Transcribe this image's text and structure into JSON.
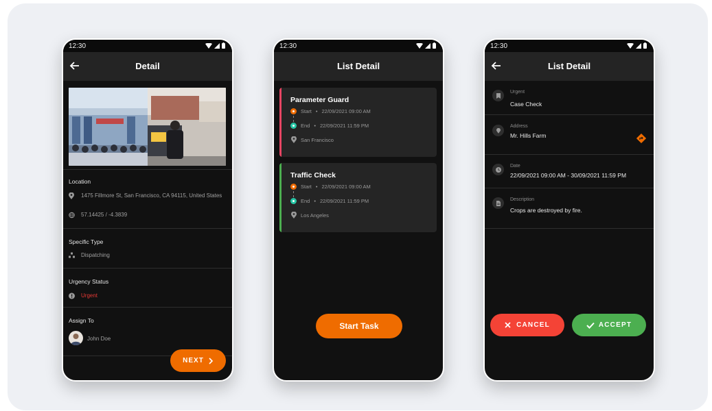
{
  "status_time": "12:30",
  "detail": {
    "title": "Detail",
    "location_title": "Location",
    "address": "1475 Fillmore St, San Francisco, CA 94115, United States",
    "coords": "57.14425 / -4.3839",
    "specific_type_title": "Specific Type",
    "specific_type": "Dispatching",
    "urgency_title": "Urgency Status",
    "urgency": "Urgent",
    "assign_title": "Assign To",
    "assignee": "John Doe",
    "next_label": "NEXT",
    "colors": {
      "urgent": "#e53935",
      "accent": "#ef6c00"
    }
  },
  "list": {
    "title": "List Detail",
    "tasks": [
      {
        "title": "Parameter Guard",
        "start_label": "Start",
        "start": "22/09/2021 09:00 AM",
        "end_label": "End",
        "end": "22/09/2021 11:59 PM",
        "location": "San Francisco",
        "color": "#e84563"
      },
      {
        "title": "Traffic Check",
        "start_label": "Start",
        "start": "22/09/2021 09:00 AM",
        "end_label": "End",
        "end": "22/09/2021 11:59 PM",
        "location": "Los Angeles",
        "color": "#4caf50"
      }
    ],
    "start_button": "Start Task"
  },
  "list_detail": {
    "title": "List Detail",
    "fields": [
      {
        "label": "Urgent",
        "value": "Case Check",
        "icon": "bookmark-icon"
      },
      {
        "label": "Address",
        "value": "Mr. Hills Farm",
        "icon": "location-pin-icon"
      },
      {
        "label": "Date",
        "value": "22/09/2021 09:00 AM - 30/09/2021 11:59 PM",
        "icon": "clock-icon"
      },
      {
        "label": "Description",
        "value": "Crops are destroyed by fire.",
        "icon": "document-icon"
      }
    ],
    "cancel_label": "CANCEL",
    "accept_label": "ACCEPT",
    "colors": {
      "cancel": "#f44336",
      "accept": "#4caf50",
      "directions": "#ef6c00"
    }
  }
}
